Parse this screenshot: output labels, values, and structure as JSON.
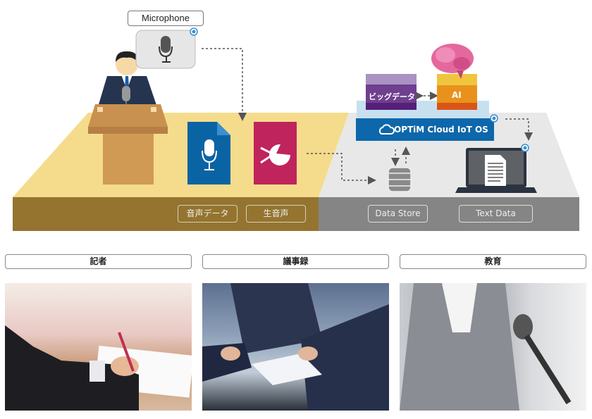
{
  "diagram": {
    "microphone_label": "Microphone",
    "cloud_os_label": "OPTiM Cloud IoT OS",
    "bigdata_label": "ビッグデータ",
    "ai_label": "AI",
    "platform_labels": [
      "音声データ",
      "生音声",
      "Data Store",
      "Text Data"
    ],
    "colors": {
      "yellow_top": "#f5dc8c",
      "yellow_front": "#94742f",
      "gray_top": "#e8e8e8",
      "gray_front": "#858585",
      "cloud_blue": "#0d67aa",
      "doc_blue": "#0a64a4",
      "raw_pink": "#c0245c",
      "bigdata_purple": "#6a3a8a",
      "ai_orange": "#e8921c"
    },
    "icons": [
      "microphone-icon",
      "person-speaker",
      "podium",
      "audio-file-icon",
      "raw-voice-icon",
      "cloud-icon",
      "database-icon",
      "laptop-icon",
      "text-document-icon",
      "brain-icon"
    ]
  },
  "use_cases": [
    {
      "title": "記者",
      "image": "journalist writing notes photo"
    },
    {
      "title": "議事録",
      "image": "business meeting photo"
    },
    {
      "title": "教育",
      "image": "speaker at microphone photo"
    }
  ]
}
